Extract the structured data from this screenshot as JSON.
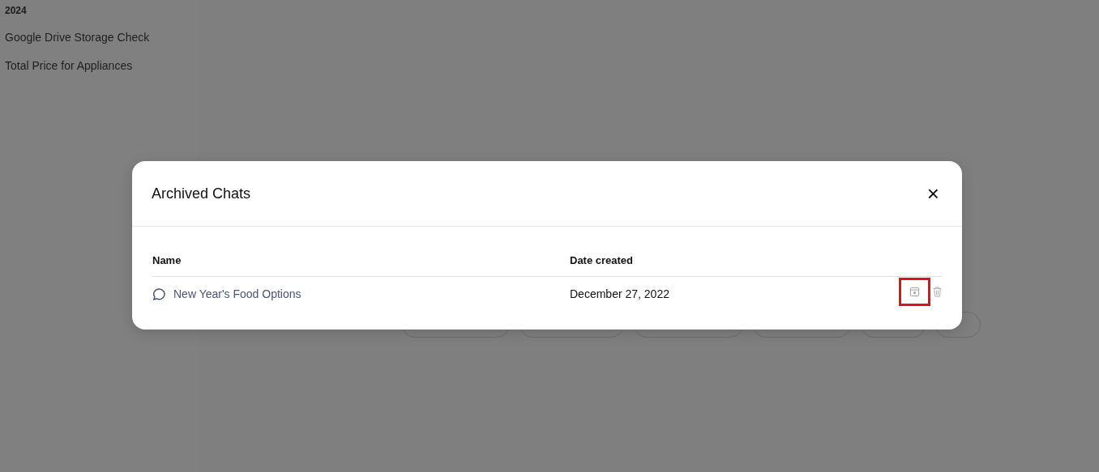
{
  "sidebar": {
    "section_label": "2024",
    "items": [
      {
        "label": "Google Drive Storage Check"
      },
      {
        "label": "Total Price for Appliances"
      }
    ]
  },
  "dialog": {
    "title": "Archived Chats",
    "close_icon": "×",
    "columns": [
      "Name",
      "Date created"
    ],
    "rows": [
      {
        "name": "New Year's Food Options",
        "date": "December 27, 2022",
        "unarchive_highlighted": true
      }
    ]
  }
}
